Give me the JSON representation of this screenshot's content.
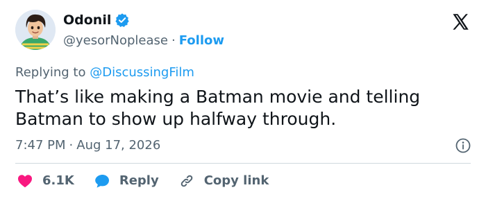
{
  "author": {
    "name": "Odonil",
    "handle": "@yesorNoplease",
    "separator": "·",
    "follow_label": "Follow",
    "avatar": "cartoon-boy-avatar",
    "verified": true
  },
  "platform_logo": "x-logo",
  "reply_context": {
    "prefix": "Replying to",
    "mention": "@DiscussingFilm"
  },
  "tweet": {
    "text": "That’s like making a Batman movie and telling\nBatman to show up halfway through."
  },
  "meta": {
    "time": "7:47 PM",
    "separator": "·",
    "date": "Aug 17, 2026"
  },
  "actions": {
    "likes_label": "6.1K",
    "reply_label": "Reply",
    "copy_link_label": "Copy link"
  },
  "colors": {
    "accent": "#1d9bf0",
    "heart": "#f91880",
    "text": "#0f1419",
    "muted": "#536471",
    "divider": "#cfd9de"
  }
}
